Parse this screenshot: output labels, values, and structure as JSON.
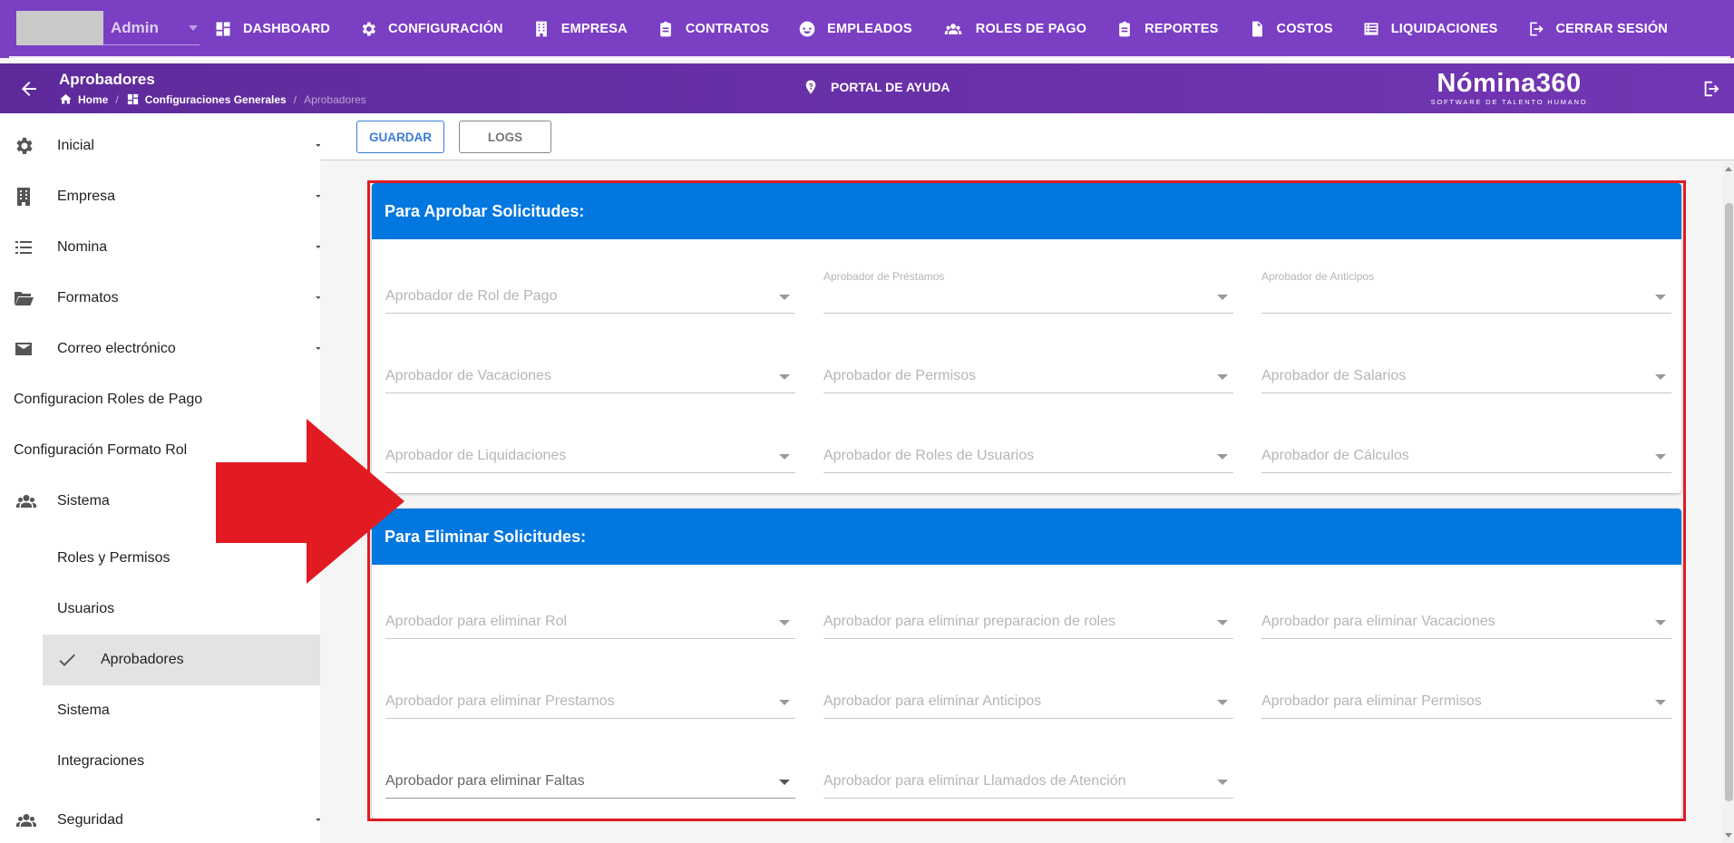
{
  "user": {
    "name": "Admin"
  },
  "nav": [
    {
      "label": "DASHBOARD",
      "icon": "dashboard-icon"
    },
    {
      "label": "CONFIGURACIÓN",
      "icon": "gear-icon"
    },
    {
      "label": "EMPRESA",
      "icon": "building-icon"
    },
    {
      "label": "CONTRATOS",
      "icon": "clipboard-icon"
    },
    {
      "label": "EMPLEADOS",
      "icon": "face-icon"
    },
    {
      "label": "ROLES DE PAGO",
      "icon": "users-icon"
    },
    {
      "label": "REPORTES",
      "icon": "clipboard-icon"
    },
    {
      "label": "COSTOS",
      "icon": "file-dollar-icon"
    },
    {
      "label": "LIQUIDACIONES",
      "icon": "list-icon"
    },
    {
      "label": "CERRAR SESIÓN",
      "icon": "logout-icon"
    }
  ],
  "header": {
    "title": "Aprobadores",
    "breadcrumb": [
      "Home",
      "Configuraciones Generales",
      "Aprobadores"
    ],
    "help": "PORTAL DE AYUDA",
    "logo_main": "Nómina360",
    "logo_sub": "SOFTWARE DE TALENTO HUMANO"
  },
  "sidebar": [
    {
      "label": "Inicial",
      "icon": "gear-icon"
    },
    {
      "label": "Empresa",
      "icon": "building-icon"
    },
    {
      "label": "Nomina",
      "icon": "list-icon"
    },
    {
      "label": "Formatos",
      "icon": "folder-open-icon"
    },
    {
      "label": "Correo electrónico",
      "icon": "mail-icon"
    },
    {
      "label": "Configuracion Roles de Pago"
    },
    {
      "label": "Configuración Formato Rol"
    },
    {
      "label": "Sistema",
      "icon": "users-icon"
    },
    {
      "label": "Roles y Permisos"
    },
    {
      "label": "Usuarios"
    },
    {
      "label": "Aprobadores",
      "icon": "check-icon",
      "active": true
    },
    {
      "label": "Sistema"
    },
    {
      "label": "Integraciones"
    },
    {
      "label": "Seguridad",
      "icon": "users-icon"
    }
  ],
  "toolbar": {
    "save_label": "GUARDAR",
    "logs_label": "LOGS"
  },
  "sections": [
    {
      "title": "Para Aprobar Solicitudes:",
      "fields": [
        {
          "label": "Aprobador de Rol de Pago"
        },
        {
          "label": "Aprobador de Préstamos",
          "floating": true
        },
        {
          "label": "Aprobador de Anticipos",
          "floating": true
        },
        {
          "label": "Aprobador de Vacaciones"
        },
        {
          "label": "Aprobador de Permisos"
        },
        {
          "label": "Aprobador de Salarios"
        },
        {
          "label": "Aprobador de Liquidaciones"
        },
        {
          "label": "Aprobador de Roles de Usuarios"
        },
        {
          "label": "Aprobador de Cálculos"
        }
      ]
    },
    {
      "title": "Para Eliminar Solicitudes:",
      "fields": [
        {
          "label": "Aprobador para eliminar Rol"
        },
        {
          "label": "Aprobador para eliminar preparacion de roles"
        },
        {
          "label": "Aprobador para eliminar Vacaciones"
        },
        {
          "label": "Aprobador para eliminar Prestamos"
        },
        {
          "label": "Aprobador para eliminar Anticipos"
        },
        {
          "label": "Aprobador para eliminar Permisos"
        },
        {
          "label": "Aprobador para eliminar Faltas",
          "emphasis": true
        },
        {
          "label": "Aprobador para eliminar Llamados de Atención"
        }
      ]
    }
  ],
  "colors": {
    "nav_bg": "#7b3fc4",
    "subheader_bg": "#6b31aa",
    "section_header": "#0277e0",
    "highlight_outline": "#e21b23",
    "save_button": "#3a7bd5"
  }
}
